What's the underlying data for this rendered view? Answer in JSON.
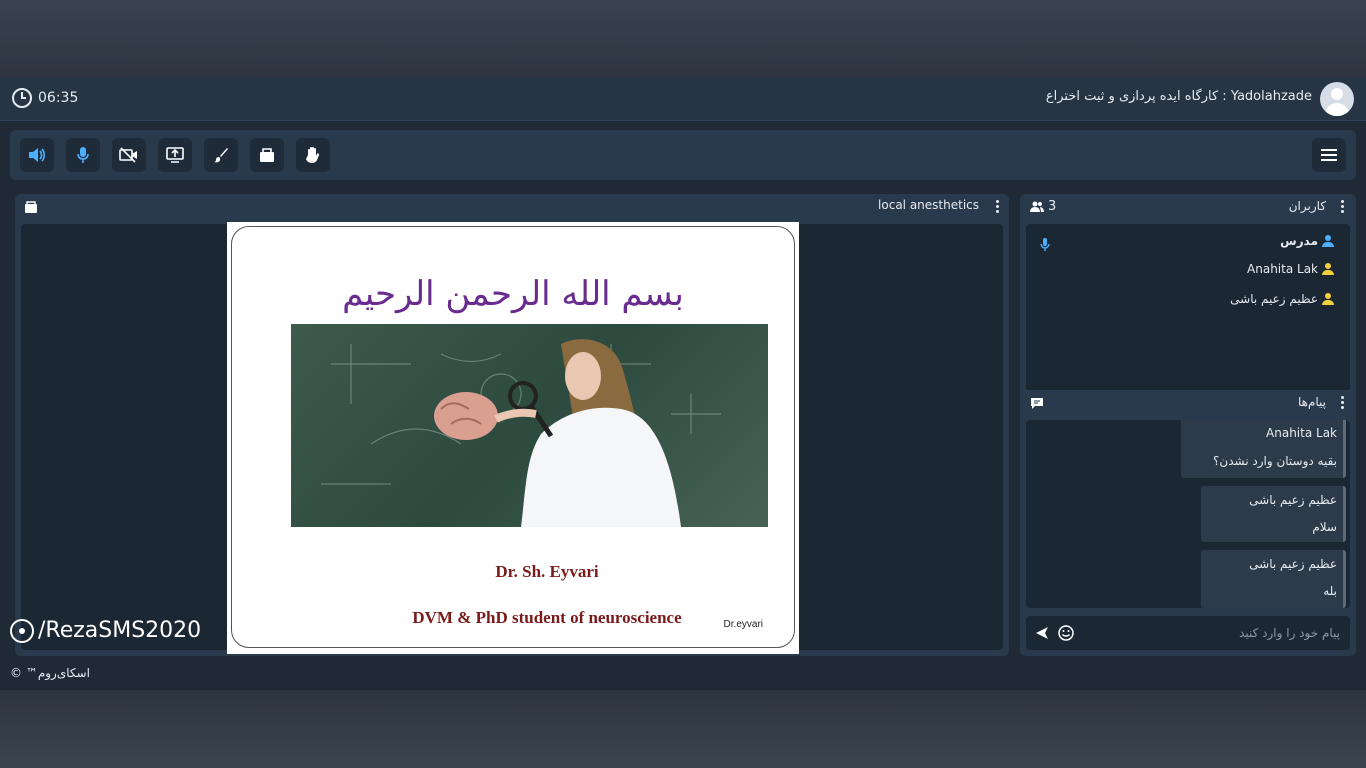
{
  "header": {
    "clock": "06:35",
    "user_name": "Yadolahzade",
    "separator": ":",
    "room_name": "کارگاه ایده پردازی و ثبت اختراع"
  },
  "toolbar": {
    "icons": [
      "speaker-icon",
      "microphone-icon",
      "camera-off-icon",
      "screen-share-icon",
      "whiteboard-brush-icon",
      "file-box-icon",
      "raise-hand-icon"
    ]
  },
  "stage": {
    "title": "local anesthetics",
    "slide": {
      "heading": "بسم الله الرحمن الرحیم",
      "name": "Dr. Sh. Eyvari",
      "subtitle": "DVM & PhD student of neuroscience",
      "credit": "Dr.eyvari"
    }
  },
  "watermark": "/RezaSMS2020",
  "users": {
    "title": "کاربران",
    "count": "3",
    "list": [
      {
        "name": "مدرس",
        "role_color": "#4ab0ff",
        "bold": true,
        "mic": true
      },
      {
        "name": "Anahita Lak",
        "role_color": "#f2d13c",
        "bold": false,
        "mic": false
      },
      {
        "name": "عظیم زعیم باشی",
        "role_color": "#f2d13c",
        "bold": false,
        "mic": false
      }
    ]
  },
  "chat": {
    "title": "پیام‌ها",
    "messages": [
      {
        "sender": "Anahita Lak",
        "text": "بقیه دوستان وارد نشدن؟"
      },
      {
        "sender": "عظیم زعیم باشی",
        "text": "سلام"
      },
      {
        "sender": "عظیم زعیم باشی",
        "text": "بله"
      }
    ],
    "input_placeholder": "پیام خود را وارد کنید"
  },
  "footer": "اسکای‌روم™ ©"
}
